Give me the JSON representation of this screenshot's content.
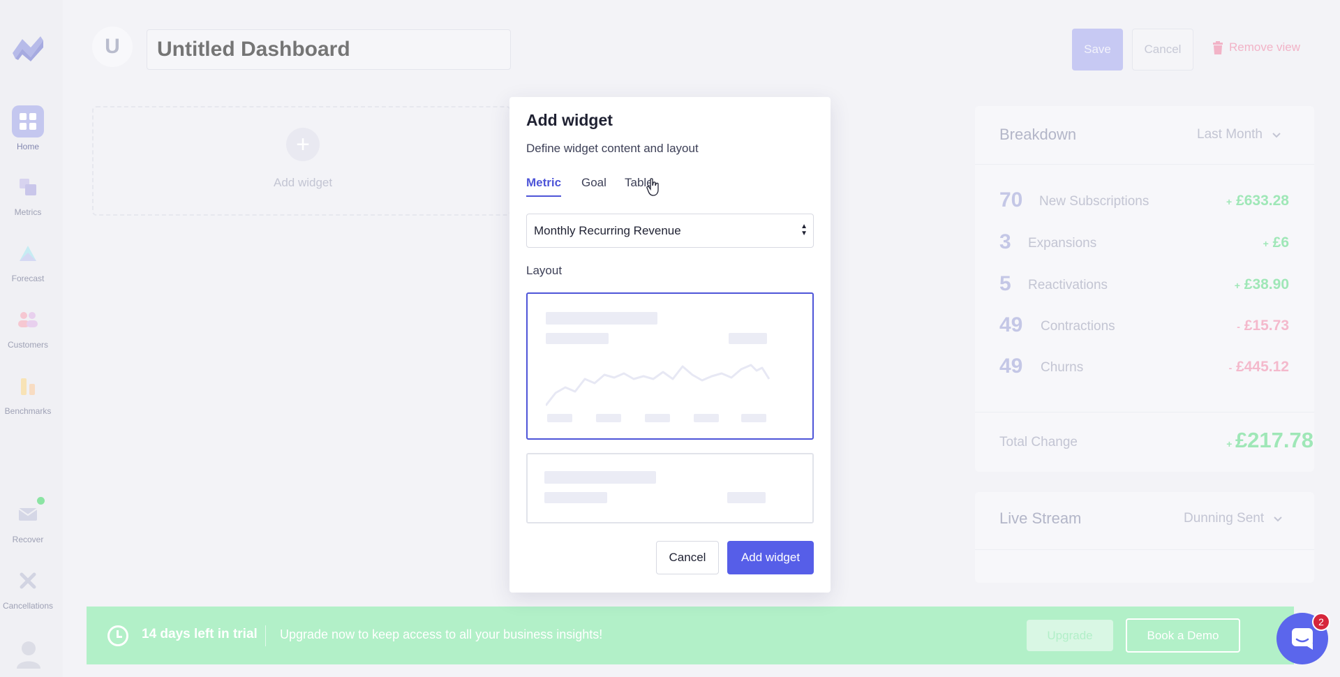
{
  "header": {
    "avatar_letter": "U",
    "dashboard_title_placeholder": "Untitled Dashboard",
    "save_label": "Save",
    "cancel_label": "Cancel",
    "remove_view_label": "Remove view"
  },
  "sidebar": {
    "items": [
      {
        "label": "Home",
        "icon": "home-icon"
      },
      {
        "label": "Metrics",
        "icon": "metrics-icon"
      },
      {
        "label": "Forecast",
        "icon": "forecast-icon"
      },
      {
        "label": "Customers",
        "icon": "customers-icon"
      },
      {
        "label": "Benchmarks",
        "icon": "benchmarks-icon"
      },
      {
        "label": "Recover",
        "icon": "mail-icon"
      },
      {
        "label": "Cancellations",
        "icon": "cancellations-icon"
      }
    ]
  },
  "placeholder": {
    "label": "Add widget"
  },
  "breakdown": {
    "title": "Breakdown",
    "period": "Last Month",
    "rows": [
      {
        "count": "70",
        "label": "New Subscriptions",
        "sign": "+",
        "value": "£633.28"
      },
      {
        "count": "3",
        "label": "Expansions",
        "sign": "+",
        "value": "£6"
      },
      {
        "count": "5",
        "label": "Reactivations",
        "sign": "+",
        "value": "£38.90"
      },
      {
        "count": "49",
        "label": "Contractions",
        "sign": "-",
        "value": "£15.73"
      },
      {
        "count": "49",
        "label": "Churns",
        "sign": "-",
        "value": "£445.12"
      }
    ],
    "total_label": "Total Change",
    "total_sign": "+",
    "total_value": "£217.78"
  },
  "live_stream": {
    "title": "Live Stream",
    "filter": "Dunning Sent"
  },
  "trial": {
    "days_left": "14 days left in trial",
    "message": "Upgrade now to keep access to all your business insights!",
    "upgrade_label": "Upgrade",
    "demo_label": "Book a Demo"
  },
  "chat": {
    "badge": "2"
  },
  "modal": {
    "title": "Add widget",
    "subtitle": "Define widget content and layout",
    "tabs": [
      "Metric",
      "Goal",
      "Table"
    ],
    "active_tab": "Metric",
    "metric_selected": "Monthly Recurring Revenue",
    "layout_label": "Layout",
    "cancel_label": "Cancel",
    "add_label": "Add widget"
  },
  "colors": {
    "accent": "#565ee8",
    "positive": "#9fe7b7",
    "negative": "#f4b9cc",
    "trial": "#b2f0c8"
  }
}
